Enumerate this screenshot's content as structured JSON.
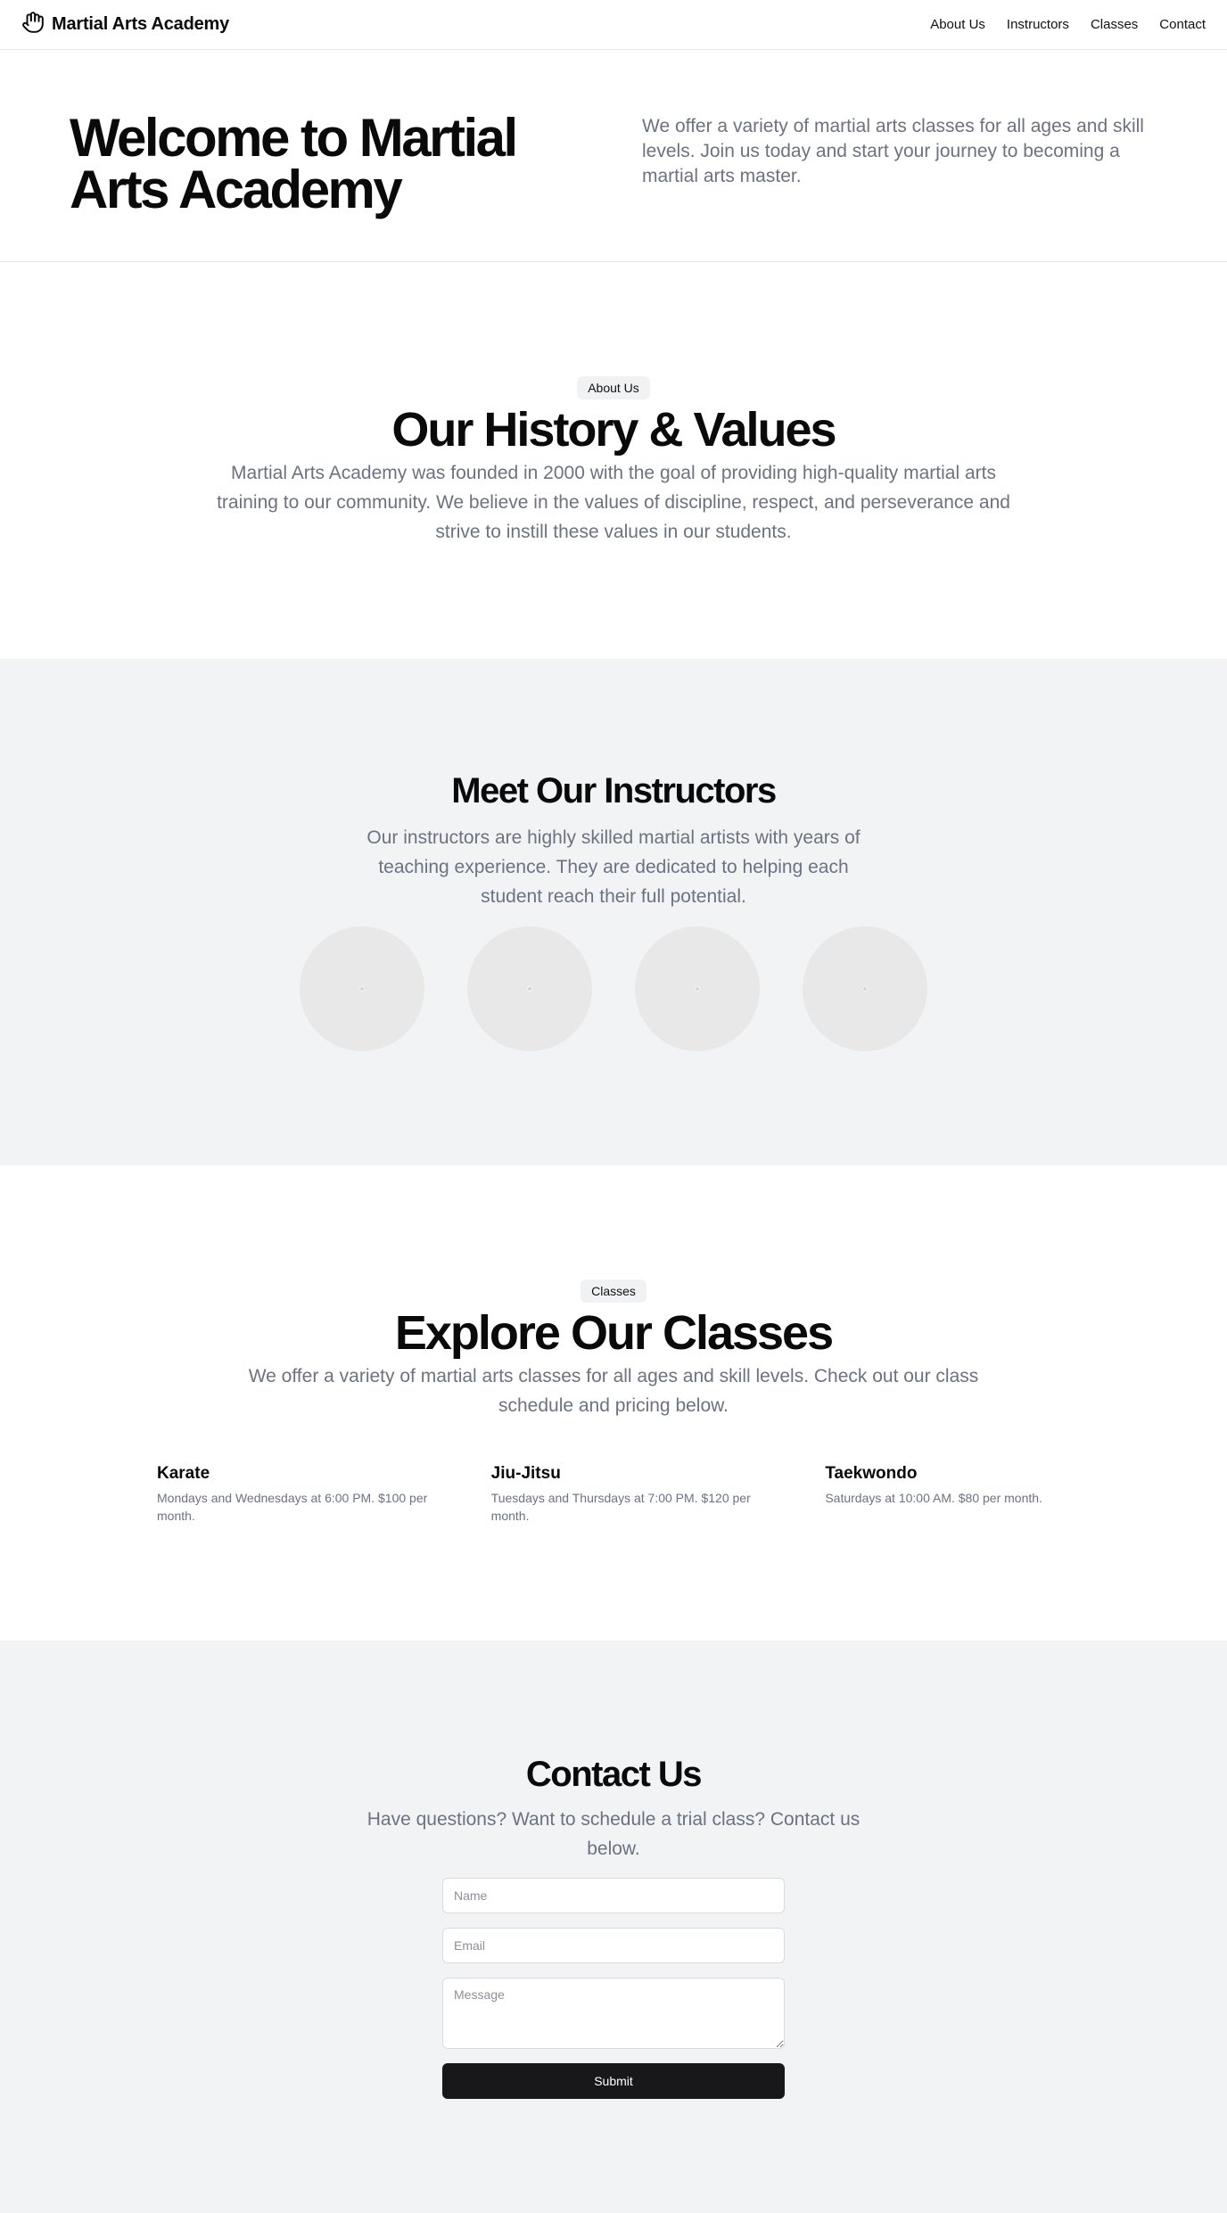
{
  "header": {
    "brand": "Martial Arts Academy",
    "brand_icon": "hand-icon",
    "nav": [
      "About Us",
      "Instructors",
      "Classes",
      "Contact"
    ]
  },
  "hero": {
    "title": "Welcome to Martial Arts Academy",
    "text": "We offer a variety of martial arts classes for all ages and skill levels. Join us today and start your journey to becoming a martial arts master."
  },
  "about": {
    "badge": "About Us",
    "title": "Our History & Values",
    "text": "Martial Arts Academy was founded in 2000 with the goal of providing high-quality martial arts training to our community. We believe in the values of discipline, respect, and perseverance and strive to instill these values in our students."
  },
  "instructors": {
    "title": "Meet Our Instructors",
    "text": "Our instructors are highly skilled martial artists with years of teaching experience. They are dedicated to helping each student reach their full potential."
  },
  "classes": {
    "badge": "Classes",
    "title": "Explore Our Classes",
    "text": "We offer a variety of martial arts classes for all ages and skill levels. Check out our class schedule and pricing below.",
    "items": [
      {
        "name": "Karate",
        "desc": "Mondays and Wednesdays at 6:00 PM. $100 per month."
      },
      {
        "name": "Jiu-Jitsu",
        "desc": "Tuesdays and Thursdays at 7:00 PM. $120 per month."
      },
      {
        "name": "Taekwondo",
        "desc": "Saturdays at 10:00 AM. $80 per month."
      }
    ]
  },
  "contact": {
    "title": "Contact Us",
    "text": "Have questions? Want to schedule a trial class? Contact us below.",
    "name_placeholder": "Name",
    "email_placeholder": "Email",
    "message_placeholder": "Message",
    "submit_label": "Submit"
  },
  "colors": {
    "muted_text": "#6b7280",
    "section_alt_bg": "#f2f3f5",
    "button_bg": "#18181b"
  }
}
